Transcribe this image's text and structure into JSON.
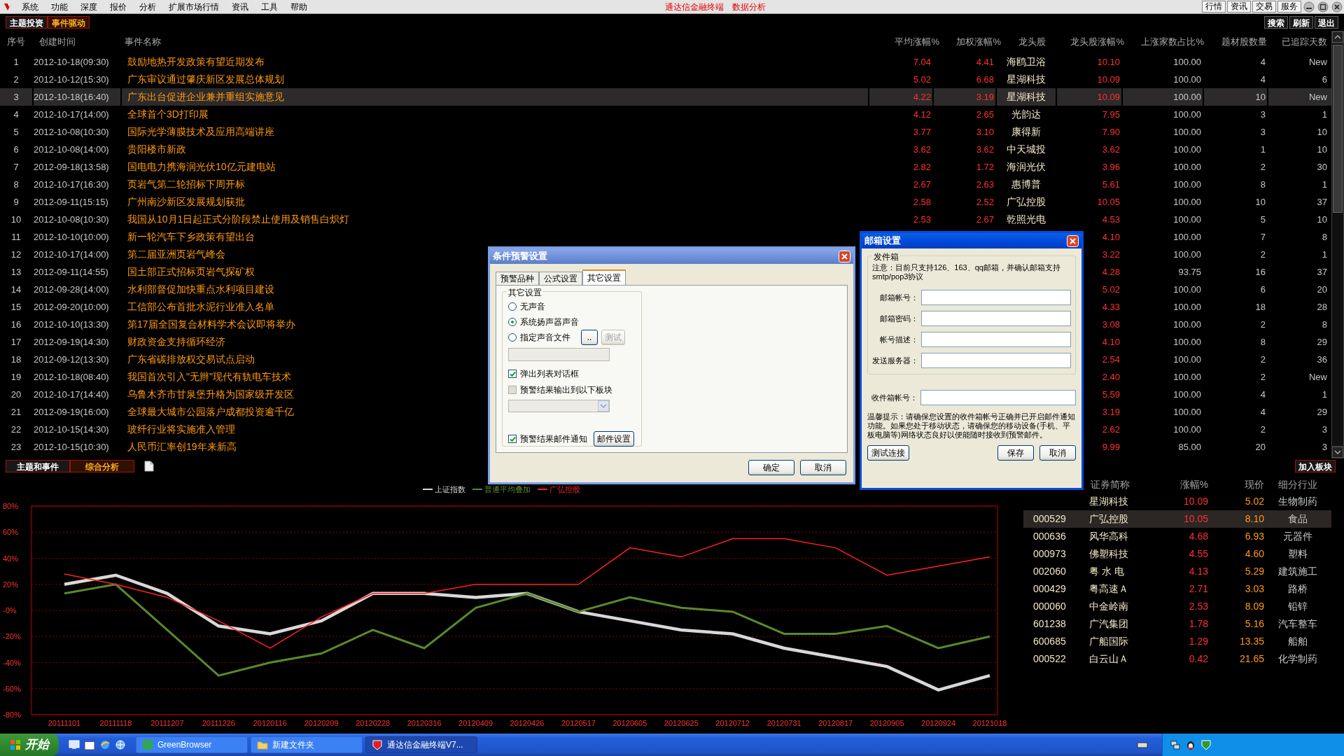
{
  "menu_bar": {
    "items": [
      "系统",
      "功能",
      "深度",
      "报价",
      "分析",
      "扩展市场行情",
      "资讯",
      "工具",
      "帮助"
    ],
    "center_titles": [
      "通达信金融终端",
      "数据分析"
    ],
    "right_buttons": [
      "行情",
      "资讯",
      "交易",
      "服务"
    ]
  },
  "top_tabs": [
    {
      "label": "主题投资",
      "selected": false
    },
    {
      "label": "事件驱动",
      "selected": true
    }
  ],
  "top_buttons": [
    "搜索",
    "刷新",
    "退出"
  ],
  "events_table": {
    "columns": [
      "序号",
      "创建时间",
      "事件名称",
      "平均涨幅%",
      "加权涨幅%",
      "龙头股",
      "龙头股涨幅%",
      "上涨家数占比%",
      "题材股数量",
      "已追踪天数"
    ],
    "rows": [
      {
        "index": "1",
        "created": "2012-10-18(09:30)",
        "name": "鼓励地热开发政策有望近期发布",
        "avg_change": "7.04",
        "weighted_change": "4.41",
        "leader": "海鸥卫浴",
        "leader_change": "10.10",
        "up_ratio": "100.00",
        "stock_count": "4",
        "days": "New",
        "selected": false
      },
      {
        "index": "2",
        "created": "2012-10-12(15:30)",
        "name": "广东审议通过肇庆新区发展总体规划",
        "avg_change": "5.02",
        "weighted_change": "6.68",
        "leader": "星湖科技",
        "leader_change": "10.09",
        "up_ratio": "100.00",
        "stock_count": "4",
        "days": "6",
        "selected": false
      },
      {
        "index": "3",
        "created": "2012-10-18(16:40)",
        "name": "广东出台促进企业兼并重组实施意见",
        "avg_change": "4.22",
        "weighted_change": "3.19",
        "leader": "星湖科技",
        "leader_change": "10.09",
        "up_ratio": "100.00",
        "stock_count": "10",
        "days": "New",
        "selected": true
      },
      {
        "index": "4",
        "created": "2012-10-17(14:00)",
        "name": "全球首个3D打印展",
        "avg_change": "4.12",
        "weighted_change": "2.65",
        "leader": "光韵达",
        "leader_change": "7.95",
        "up_ratio": "100.00",
        "stock_count": "3",
        "days": "1",
        "selected": false
      },
      {
        "index": "5",
        "created": "2012-10-08(10:30)",
        "name": "国际光学薄膜技术及应用高端讲座",
        "avg_change": "3.77",
        "weighted_change": "3.10",
        "leader": "康得新",
        "leader_change": "7.90",
        "up_ratio": "100.00",
        "stock_count": "3",
        "days": "10",
        "selected": false
      },
      {
        "index": "6",
        "created": "2012-10-08(14:00)",
        "name": "贵阳楼市新政",
        "avg_change": "3.62",
        "weighted_change": "3.62",
        "leader": "中天城投",
        "leader_change": "3.62",
        "up_ratio": "100.00",
        "stock_count": "1",
        "days": "10",
        "selected": false
      },
      {
        "index": "7",
        "created": "2012-09-18(13:58)",
        "name": "国电电力携海润光伏10亿元建电站",
        "avg_change": "2.82",
        "weighted_change": "1.72",
        "leader": "海润光伏",
        "leader_change": "3.96",
        "up_ratio": "100.00",
        "stock_count": "2",
        "days": "30",
        "selected": false
      },
      {
        "index": "8",
        "created": "2012-10-17(16:30)",
        "name": "页岩气第二轮招标下周开标",
        "avg_change": "2.67",
        "weighted_change": "2.63",
        "leader": "惠博普",
        "leader_change": "5.61",
        "up_ratio": "100.00",
        "stock_count": "8",
        "days": "1",
        "selected": false
      },
      {
        "index": "9",
        "created": "2012-09-11(15:15)",
        "name": "广州南沙新区发展规划获批",
        "avg_change": "2.58",
        "weighted_change": "2.52",
        "leader": "广弘控股",
        "leader_change": "10.05",
        "up_ratio": "100.00",
        "stock_count": "10",
        "days": "37",
        "selected": false
      },
      {
        "index": "10",
        "created": "2012-10-08(10:30)",
        "name": "我国从10月1日起正式分阶段禁止使用及销售白炽灯",
        "avg_change": "2.53",
        "weighted_change": "2.67",
        "leader": "乾照光电",
        "leader_change": "4.53",
        "up_ratio": "100.00",
        "stock_count": "5",
        "days": "10",
        "selected": false
      },
      {
        "index": "11",
        "created": "2012-10-10(10:00)",
        "name": "新一轮汽车下乡政策有望出台",
        "leader_change": "4.10",
        "up_ratio": "100.00",
        "stock_count": "7",
        "days": "8",
        "selected": false
      },
      {
        "index": "12",
        "created": "2012-10-17(14:00)",
        "name": "第二届亚洲页岩气峰会",
        "leader_change": "3.22",
        "up_ratio": "100.00",
        "stock_count": "2",
        "days": "1",
        "selected": false
      },
      {
        "index": "13",
        "created": "2012-09-11(14:55)",
        "name": "国土部正式招标页岩气探矿权",
        "leader_change": "4.28",
        "up_ratio": "93.75",
        "stock_count": "16",
        "days": "37",
        "selected": false
      },
      {
        "index": "14",
        "created": "2012-09-28(14:00)",
        "name": "水利部督促加快重点水利项目建设",
        "leader_change": "5.02",
        "up_ratio": "100.00",
        "stock_count": "6",
        "days": "20",
        "selected": false
      },
      {
        "index": "15",
        "created": "2012-09-20(10:00)",
        "name": "工信部公布首批水泥行业准入名单",
        "leader_change": "4.33",
        "up_ratio": "100.00",
        "stock_count": "18",
        "days": "28",
        "selected": false
      },
      {
        "index": "16",
        "created": "2012-10-10(13:30)",
        "name": "第17届全国复合材料学术会议即将举办",
        "leader_change": "3.08",
        "up_ratio": "100.00",
        "stock_count": "2",
        "days": "8",
        "selected": false
      },
      {
        "index": "17",
        "created": "2012-09-19(14:30)",
        "name": "财政资金支持循环经济",
        "leader_change": "4.10",
        "up_ratio": "100.00",
        "stock_count": "8",
        "days": "29",
        "selected": false
      },
      {
        "index": "18",
        "created": "2012-09-12(13:30)",
        "name": "广东省碳排放权交易试点启动",
        "leader_change": "2.54",
        "up_ratio": "100.00",
        "stock_count": "2",
        "days": "36",
        "selected": false
      },
      {
        "index": "19",
        "created": "2012-10-18(08:40)",
        "name": "我国首次引入\"无辫\"现代有轨电车技术",
        "leader_change": "2.40",
        "up_ratio": "100.00",
        "stock_count": "2",
        "days": "New",
        "selected": false
      },
      {
        "index": "20",
        "created": "2012-10-17(14:40)",
        "name": "乌鲁木齐市甘泉堡升格为国家级开发区",
        "leader_change": "5.59",
        "up_ratio": "100.00",
        "stock_count": "4",
        "days": "1",
        "selected": false
      },
      {
        "index": "21",
        "created": "2012-09-19(16:00)",
        "name": "全球最大城市公园落户成都投资逾千亿",
        "leader_change": "3.19",
        "up_ratio": "100.00",
        "stock_count": "4",
        "days": "29",
        "selected": false
      },
      {
        "index": "22",
        "created": "2012-10-15(14:30)",
        "name": "玻纤行业将实施准入管理",
        "leader_change": "2.62",
        "up_ratio": "100.00",
        "stock_count": "2",
        "days": "3",
        "selected": false
      },
      {
        "index": "23",
        "created": "2012-10-15(10:30)",
        "name": "人民币汇率创19年来新高",
        "leader_change": "9.99",
        "up_ratio": "85.00",
        "stock_count": "20",
        "days": "3",
        "selected": false
      }
    ]
  },
  "bottom_tabs": [
    {
      "label": "主题和事件",
      "selected": false
    },
    {
      "label": "综合分析",
      "selected": true
    }
  ],
  "add_button": "加入板块",
  "chart": {
    "chart_data": {
      "type": "line",
      "grid": true,
      "legend": true,
      "categories": [
        "20111101",
        "20111118",
        "20111207",
        "20111226",
        "20120116",
        "20120209",
        "20120228",
        "20120316",
        "20120409",
        "20120426",
        "20120517",
        "20120605",
        "20120625",
        "20120712",
        "20120731",
        "20120817",
        "20120905",
        "20120924",
        "20121018"
      ],
      "yticks": [
        {
          "value": 80,
          "label": "80%"
        },
        {
          "value": 60,
          "label": "60%"
        },
        {
          "value": 40,
          "label": "40%"
        },
        {
          "value": 20,
          "label": "20%"
        },
        {
          "value": 0,
          "label": "-0%"
        },
        {
          "value": -20,
          "label": "-20%"
        },
        {
          "value": -40,
          "label": "-40%"
        },
        {
          "value": -60,
          "label": "-60%"
        },
        {
          "value": -80,
          "label": "-80%"
        }
      ],
      "ylim": [
        -80,
        80
      ],
      "series": [
        {
          "name": "上证指数",
          "color": "#d8d8d8",
          "values": [
            20,
            27,
            13,
            -12,
            -18,
            -8,
            13,
            13,
            10,
            13,
            -1,
            -8,
            -15,
            -18,
            -29,
            -36,
            -43,
            -61,
            -50
          ]
        },
        {
          "name": "普通平均叠加",
          "color": "#5a8a2a",
          "values": [
            13,
            20,
            -15,
            -50,
            -40,
            -33,
            -15,
            -29,
            2,
            13,
            -1,
            10,
            2,
            -1,
            -18,
            -18,
            -12,
            -29,
            -20
          ]
        },
        {
          "name": "广弘控股",
          "color": "#ff2020",
          "values": [
            28,
            20,
            10,
            -8,
            -29,
            -5,
            13,
            13,
            20,
            20,
            20,
            48,
            41,
            55,
            55,
            48,
            27,
            34,
            41
          ]
        }
      ]
    }
  },
  "stock_table": {
    "columns": [
      "证券简称",
      "涨幅%",
      "现价",
      "细分行业"
    ],
    "rows": [
      {
        "name": "星湖科技",
        "change": "10.09",
        "price": "5.02",
        "industry": "生物制药",
        "selected": false
      },
      {
        "code": "000529",
        "name": "广弘控股",
        "change": "10.05",
        "price": "8.10",
        "industry": "食品",
        "selected": true
      },
      {
        "code": "000636",
        "name": "风华高科",
        "change": "4.68",
        "price": "6.93",
        "industry": "元器件",
        "selected": false
      },
      {
        "code": "000973",
        "name": "佛塑科技",
        "change": "4.55",
        "price": "4.60",
        "industry": "塑料",
        "selected": false
      },
      {
        "code": "002060",
        "name": "粤 水 电",
        "change": "4.13",
        "price": "5.29",
        "industry": "建筑施工",
        "selected": false
      },
      {
        "code": "000429",
        "name": "粤高速Ａ",
        "change": "2.71",
        "price": "3.03",
        "industry": "路桥",
        "selected": false
      },
      {
        "code": "000060",
        "name": "中金岭南",
        "change": "2.53",
        "price": "8.09",
        "industry": "铅锌",
        "selected": false
      },
      {
        "code": "601238",
        "name": "广汽集团",
        "change": "1.78",
        "price": "5.16",
        "industry": "汽车整车",
        "selected": false
      },
      {
        "code": "600685",
        "name": "广船国际",
        "change": "1.29",
        "price": "13.35",
        "industry": "船舶",
        "selected": false
      },
      {
        "code": "000522",
        "name": "白云山Ａ",
        "change": "0.42",
        "price": "21.65",
        "industry": "化学制药",
        "selected": false
      }
    ]
  },
  "alert_dialog": {
    "title": "条件预警设置",
    "tabs": [
      {
        "label": "预警品种",
        "selected": false
      },
      {
        "label": "公式设置",
        "selected": false
      },
      {
        "label": "其它设置",
        "selected": true
      }
    ],
    "group_title": "其它设置",
    "sound_options": [
      {
        "label": "无声音",
        "selected": false
      },
      {
        "label": "系统扬声器声音",
        "selected": true
      },
      {
        "label": "指定声音文件",
        "selected": false
      }
    ],
    "browse_button": "..",
    "test_button": {
      "label": "测试",
      "disabled": true
    },
    "options": [
      {
        "label": "弹出列表对话框",
        "checked": true,
        "disabled": false
      },
      {
        "label": "预警结果输出到以下板块",
        "checked": false,
        "disabled": true
      },
      {
        "label": "预警结果邮件通知",
        "checked": true,
        "disabled": false
      }
    ],
    "mail_settings_button": "邮件设置",
    "buttons": [
      "确定",
      "取消"
    ]
  },
  "mail_dialog": {
    "title": "邮箱设置",
    "group_title": "发件箱",
    "note": "注意：目前只支持126、163、qq邮箱，并确认邮箱支持smtp/pop3协议",
    "fields": [
      {
        "label": "邮箱帐号："
      },
      {
        "label": "邮箱密码："
      },
      {
        "label": "帐号描述："
      },
      {
        "label": "发送服务器："
      }
    ],
    "receiver_label": "收件箱帐号：",
    "tip": "温馨提示：请确保您设置的收件箱帐号正确并已开启邮件通知功能。如果您处于移动状态，请确保您的移动设备(手机、平板电脑等)网络状态良好以便能随时接收到预警邮件。",
    "buttons": [
      "测试连接",
      "保存",
      "取消"
    ]
  },
  "taskbar": {
    "start": "开始",
    "tasks": [
      {
        "label": "GreenBrowser",
        "selected": false
      },
      {
        "label": "新建文件夹",
        "selected": false
      },
      {
        "label": "通达信金融终端V7...",
        "selected": true
      }
    ]
  }
}
